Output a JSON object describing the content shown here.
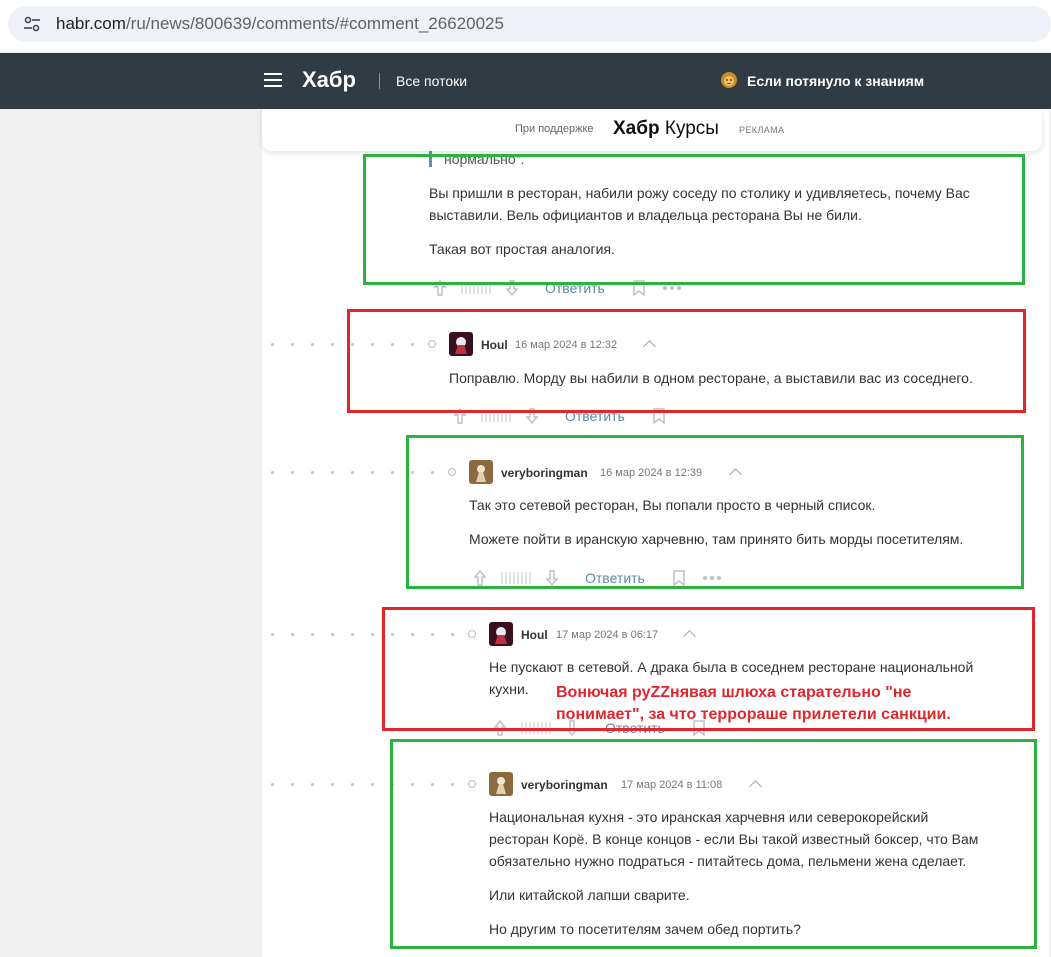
{
  "browser": {
    "url_host": "habr.com",
    "url_path": "/ru/news/800639/comments/#comment_26620025"
  },
  "header": {
    "logo": "Хабр",
    "flows": "Все потоки",
    "promo": "Если потянуло к знаниям"
  },
  "sponsor": {
    "support": "При поддержке",
    "brand_bold": "Хабр",
    "brand_rest": " Курсы",
    "ad": "РЕКЛАМА"
  },
  "comments": [
    {
      "quote_tail": "нормально\".",
      "paragraphs": [
        "Вы пришли в ресторан, набили рожу соседу по столику и удивляетесь, почему Вас",
        "выставили. Вель официантов и владельца ресторана Вы не били.",
        "Такая вот простая аналогия."
      ],
      "reply": "Ответить"
    },
    {
      "author": "Houl",
      "time": "16 мар 2024 в 12:32",
      "paragraphs": [
        "Поправлю. Морду вы набили в одном ресторане, а выставили вас из соседнего."
      ],
      "reply": "Ответить"
    },
    {
      "author": "veryboringman",
      "time": "16 мар 2024 в 12:39",
      "paragraphs": [
        "Так это сетевой ресторан, Вы попали просто в черный список.",
        "Можете пойти в иранскую харчевню, там принято бить морды посетителям."
      ],
      "reply": "Ответить"
    },
    {
      "author": "Houl",
      "time": "17 мар 2024 в 06:17",
      "paragraphs": [
        "Не пускают в сетевой. А драка была в соседнем ресторане национальной",
        "кухни."
      ],
      "reply": "Ответить"
    },
    {
      "author": "veryboringman",
      "time": "17 мар 2024 в 11:08",
      "paragraphs": [
        "Национальная кухня - это иранская харчевня или северокорейский",
        "ресторан Корё. В конце концов - если Вы такой известный боксер, что Вам",
        "обязательно нужно подраться - питайтесь дома, пельмени жена сделает.",
        "Или китайской лапши сварите.",
        "Но другим то посетителям зачем обед портить?"
      ]
    }
  ],
  "annotation": {
    "line1": "Вонючая руZZнявая шлюха старательно \"не",
    "line2": "понимает\", за что терроpаше прилетели санкции."
  },
  "colors": {
    "header_bg": "#303b44",
    "green_box": "#2bb33f",
    "red_box": "#e1262d",
    "link": "#5e8aa8"
  }
}
